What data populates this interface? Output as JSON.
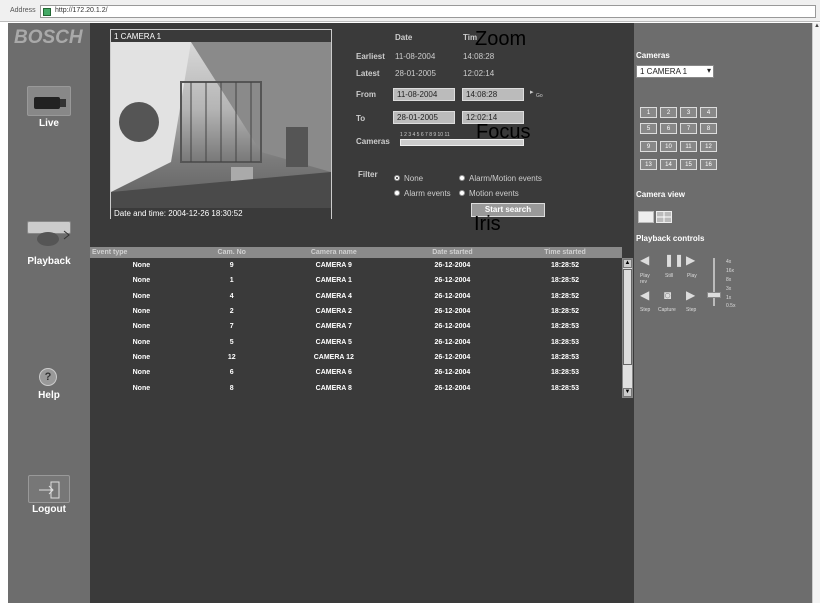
{
  "browser": {
    "address_label": "Address",
    "url": "http://172.20.1.2/"
  },
  "nav": {
    "logo": "BOSCH",
    "live": "Live",
    "playback": "Playback",
    "help": "Help",
    "logout": "Logout"
  },
  "camera_view": {
    "header": "1 CAMERA 1",
    "footer": "Date and time:  2004-12-26 18:30:52"
  },
  "search": {
    "date_header": "Date",
    "time_header": "Tim",
    "earliest_label": "Earliest",
    "earliest_date": "11-08-2004",
    "earliest_time": "14:08:28",
    "latest_label": "Latest",
    "latest_date": "28-01-2005",
    "latest_time": "12:02:14",
    "from_label": "From",
    "from_date": "11-08-2004",
    "from_time": "14:08:28",
    "go_label": "Go",
    "to_label": "To",
    "to_date": "28-01-2005",
    "to_time": "12:02:14",
    "cameras_label": "Cameras",
    "camera_numbers": "1 2 3 4 5 6 7 8 9 10 11",
    "filter_label": "Filter",
    "filter_none": "None",
    "filter_alarm_motion": "Alarm/Motion events",
    "filter_alarm": "Alarm events",
    "filter_motion": "Motion events",
    "start_search": "Start search"
  },
  "overlays": {
    "zoom": "Zoom",
    "focus": "Focus",
    "iris": "Iris"
  },
  "table": {
    "headers": [
      "Event type",
      "Cam. No",
      "Camera name",
      "Date started",
      "Time started"
    ],
    "rows": [
      [
        "None",
        "9",
        "CAMERA 9",
        "26-12-2004",
        "18:28:52"
      ],
      [
        "None",
        "1",
        "CAMERA 1",
        "26-12-2004",
        "18:28:52"
      ],
      [
        "None",
        "4",
        "CAMERA 4",
        "26-12-2004",
        "18:28:52"
      ],
      [
        "None",
        "2",
        "CAMERA 2",
        "26-12-2004",
        "18:28:52"
      ],
      [
        "None",
        "7",
        "CAMERA 7",
        "26-12-2004",
        "18:28:53"
      ],
      [
        "None",
        "5",
        "CAMERA 5",
        "26-12-2004",
        "18:28:53"
      ],
      [
        "None",
        "12",
        "CAMERA 12",
        "26-12-2004",
        "18:28:53"
      ],
      [
        "None",
        "6",
        "CAMERA 6",
        "26-12-2004",
        "18:28:53"
      ],
      [
        "None",
        "8",
        "CAMERA 8",
        "26-12-2004",
        "18:28:53"
      ]
    ]
  },
  "right": {
    "cameras_label": "Cameras",
    "camera_select": "1 CAMERA 1",
    "camera_buttons": [
      "1",
      "2",
      "3",
      "4",
      "5",
      "6",
      "7",
      "8",
      "9",
      "10",
      "11",
      "12",
      "13",
      "14",
      "15",
      "16"
    ],
    "camera_view_label": "Camera view",
    "playback_label": "Playback controls",
    "play_rev": "Play rev",
    "still": "Still",
    "play": "Play",
    "step_back": "Step",
    "capture": "Capture",
    "step_fwd": "Step",
    "speeds": [
      "4x",
      "16x",
      "8x",
      "3x",
      "1x",
      "0.5x"
    ]
  }
}
